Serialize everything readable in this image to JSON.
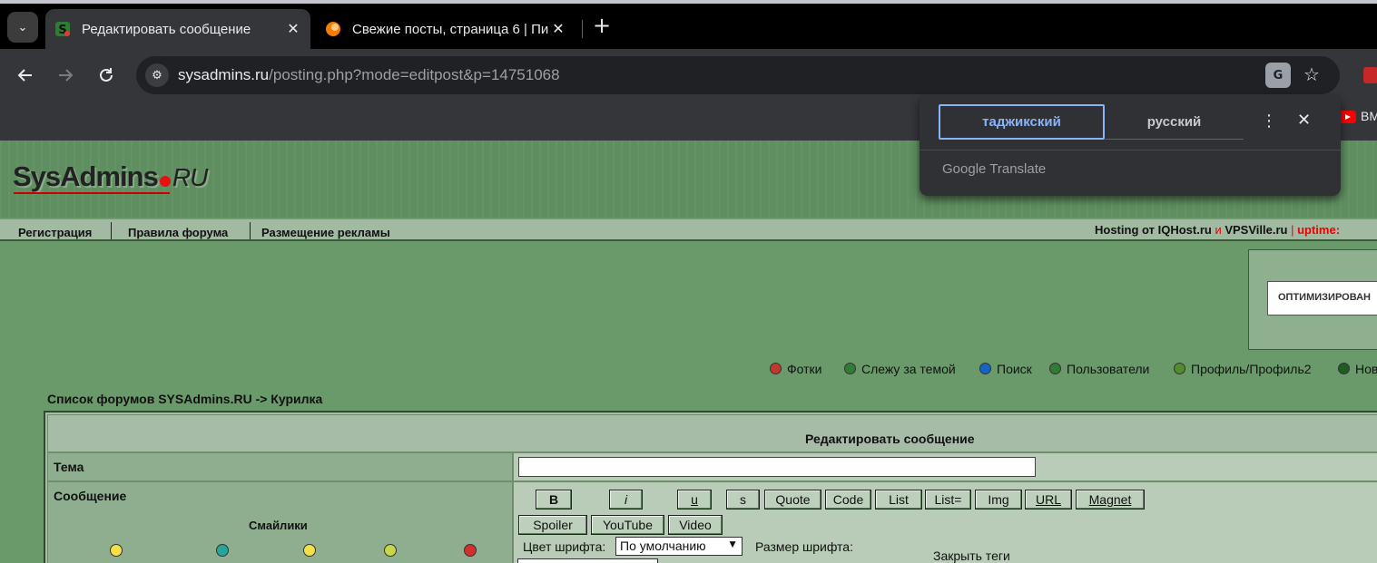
{
  "browser": {
    "tabs": [
      {
        "title": "Редактировать сообщение",
        "active": true,
        "icon": "sysadmins-favicon"
      },
      {
        "title": "Свежие посты, страница 6 | Пи",
        "active": false,
        "icon": "orange-favicon"
      }
    ],
    "tab_close": "✕",
    "new_tab": "+",
    "url_host": "sysadmins.ru",
    "url_path": "/posting.php?mode=editpost&p=14751068",
    "bookmark_label": "BMW",
    "colors": {
      "frame": "#000000",
      "toolbar": "#35363a",
      "omnibox": "#202124",
      "accent": "#8ab4f8"
    }
  },
  "translate_popup": {
    "source_lang": "таджикский",
    "target_lang": "русский",
    "brand": "Google Translate"
  },
  "site": {
    "logo_main": "SysAdmins",
    "logo_suffix": "RU",
    "nav": [
      "Регистрация",
      "Правила форума",
      "Размещение рекламы"
    ],
    "hosting": {
      "prefix": "Hosting от ",
      "iqhost": "IQHost.ru",
      "and": " и ",
      "vpsville": "VPSVille.ru",
      "sep": " | ",
      "uptime": "uptime:"
    },
    "ad_text": "ОПТИМИЗИРОВАН",
    "user_links": [
      {
        "label": "Фотки",
        "icon": "photos-icon",
        "color": "#c0392b"
      },
      {
        "label": "Слежу за темой",
        "icon": "watch-icon",
        "color": "#2e7d32"
      },
      {
        "label": "Поиск",
        "icon": "search-icon",
        "color": "#1565c0"
      },
      {
        "label": "Пользователи",
        "icon": "users-icon",
        "color": "#2e7d32"
      },
      {
        "label": "Профиль/Профиль2",
        "icon": "profile-icon",
        "color": "#558b2f"
      },
      {
        "label": "Нов",
        "icon": "new-icon",
        "color": "#1b5e20"
      }
    ],
    "breadcrumb": "Список форумов SYSAdmins.RU -> Курилка",
    "form": {
      "title": "Редактировать сообщение",
      "subject_label": "Тема",
      "subject_value": "",
      "message_label": "Сообщение",
      "smilies_label": "Смайлики",
      "bbcode_row1": [
        "B",
        "i",
        "u",
        "s",
        "Quote",
        "Code",
        "List",
        "List=",
        "Img",
        "URL",
        "Magnet"
      ],
      "bbcode_row2": [
        "Spoiler",
        "YouTube",
        "Video"
      ],
      "font_color_label": "Цвет шрифта:",
      "font_color_value": "По умолчанию",
      "font_size_label": "Размер шрифта:",
      "close_tags": "Закрыть теги"
    }
  }
}
